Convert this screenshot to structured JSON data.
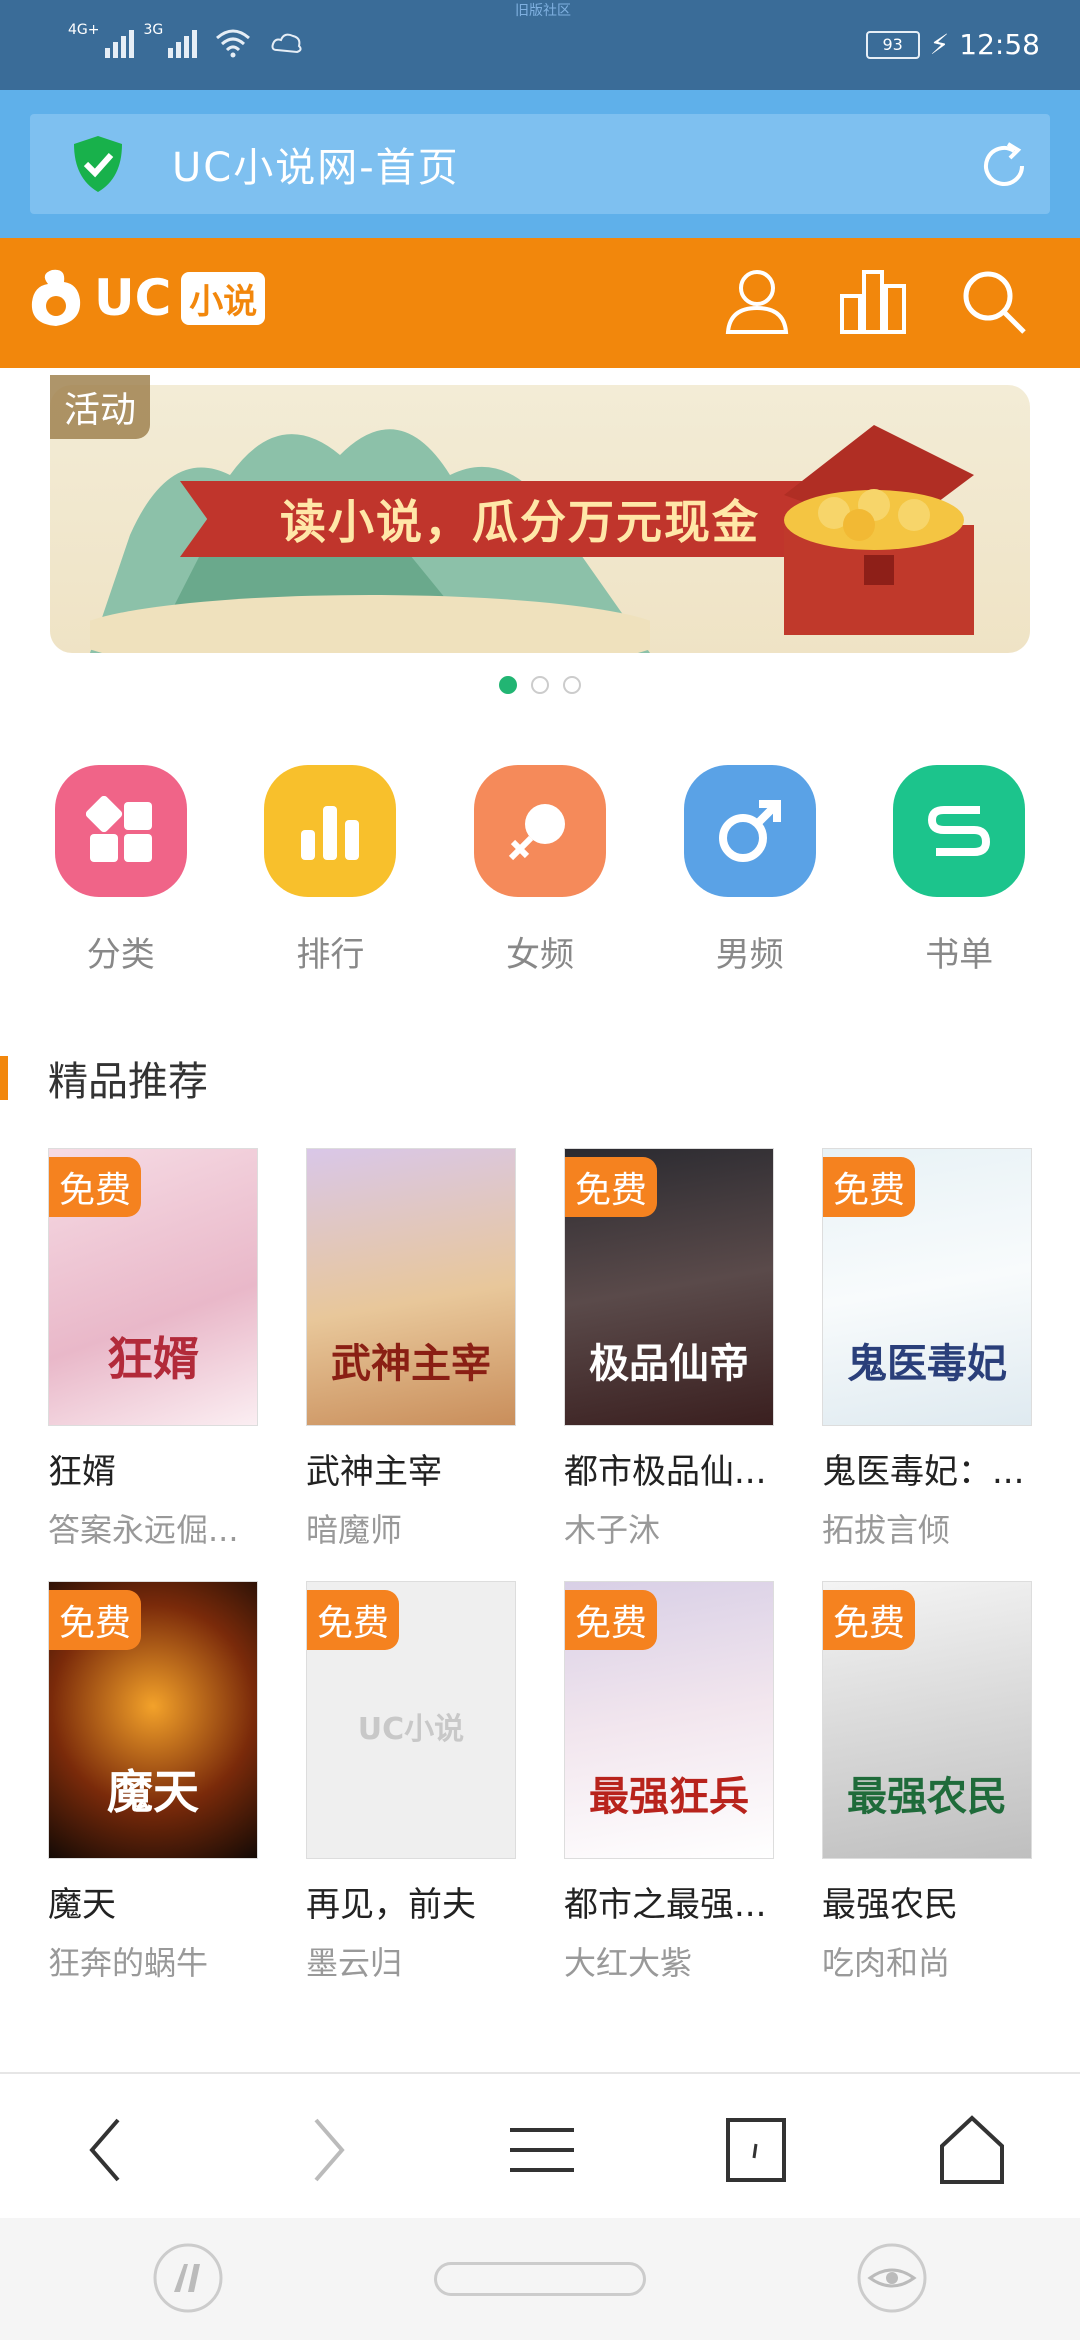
{
  "status_bar": {
    "carrier_text": "旧版社区",
    "signal1_label": "4G+",
    "signal2_label": "3G",
    "battery": "93",
    "time": "12:58"
  },
  "address_bar": {
    "title": "UC小说网-首页"
  },
  "header": {
    "logo_text": "UC",
    "logo_tag": "小说"
  },
  "banner": {
    "badge": "活动",
    "headline": "读小说，瓜分万元现金",
    "page_count": 3,
    "active_index": 0
  },
  "categories": [
    {
      "label": "分类",
      "color": "#f06488"
    },
    {
      "label": "排行",
      "color": "#f8c02c"
    },
    {
      "label": "女频",
      "color": "#f58a5a"
    },
    {
      "label": "男频",
      "color": "#5aa2e6"
    },
    {
      "label": "书单",
      "color": "#1cc48c"
    }
  ],
  "section": {
    "title": "精品推荐"
  },
  "books": [
    {
      "name": "狂婿",
      "author": "答案永远倔...",
      "free": "免费",
      "cover_text": "狂婿"
    },
    {
      "name": "武神主宰",
      "author": "暗魔师",
      "free": "",
      "cover_text": "武神主宰"
    },
    {
      "name": "都市极品仙...",
      "author": "木子沐",
      "free": "免费",
      "cover_text": "极品仙帝"
    },
    {
      "name": "鬼医毒妃：...",
      "author": "拓拔言倾",
      "free": "免费",
      "cover_text": "鬼医毒妃"
    },
    {
      "name": "魔天",
      "author": "狂奔的蜗牛",
      "free": "免费",
      "cover_text": "魔天"
    },
    {
      "name": "再见，前夫",
      "author": "墨云归",
      "free": "免费",
      "cover_text": "UC小说"
    },
    {
      "name": "都市之最强...",
      "author": "大红大紫",
      "free": "免费",
      "cover_text": "最强狂兵"
    },
    {
      "name": "最强农民",
      "author": "吃肉和尚",
      "free": "免费",
      "cover_text": "最强农民"
    }
  ],
  "colors": {
    "brand_orange": "#f2870c",
    "address_blue": "#5fb0ea",
    "status_blue": "#3a6c98",
    "accent_green": "#22b573"
  }
}
